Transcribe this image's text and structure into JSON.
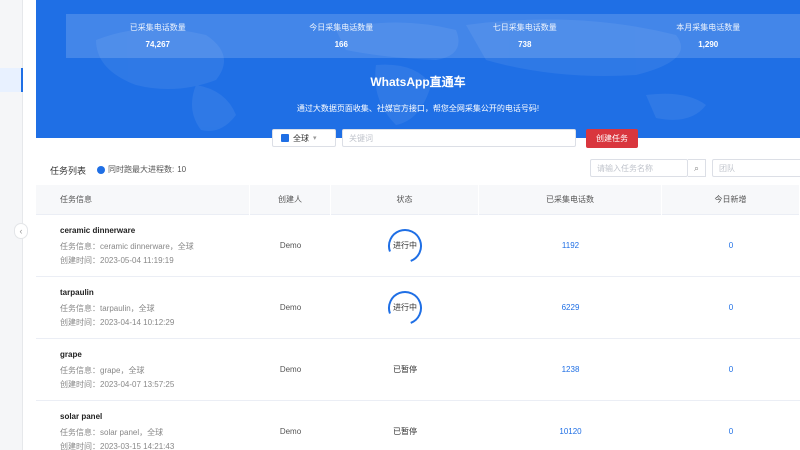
{
  "stats": [
    {
      "label": "已采集电话数量",
      "value": "74,267"
    },
    {
      "label": "今日采集电话数量",
      "value": "166"
    },
    {
      "label": "七日采集电话数量",
      "value": "738"
    },
    {
      "label": "本月采集电话数量",
      "value": "1,290"
    }
  ],
  "banner": {
    "title": "WhatsApp直通车",
    "subtitle": "通过大数据页面收集、社媒官方接口，帮您全网采集公开的电话号码!"
  },
  "search": {
    "scope": "全球",
    "placeholder": "关键词",
    "create_label": "创建任务"
  },
  "list": {
    "title": "任务列表",
    "process_label": "同时跑最大进程数:",
    "process_value": "10",
    "task_search_placeholder": "请输入任务名称",
    "team_placeholder": "团队"
  },
  "table": {
    "headers": [
      "任务信息",
      "创建人",
      "状态",
      "已采集电话数",
      "今日新增"
    ],
    "rows": [
      {
        "name": "ceramic dinnerware",
        "info": "任务信息：ceramic dinnerware，全球",
        "time": "创建时间：2023-05-04 11:19:19",
        "creator": "Demo",
        "status": "进行中",
        "running": true,
        "collected": "1192",
        "today": "0"
      },
      {
        "name": "tarpaulin",
        "info": "任务信息：tarpaulin，全球",
        "time": "创建时间：2023-04-14 10:12:29",
        "creator": "Demo",
        "status": "进行中",
        "running": true,
        "collected": "6229",
        "today": "0"
      },
      {
        "name": "grape",
        "info": "任务信息：grape，全球",
        "time": "创建时间：2023-04-07 13:57:25",
        "creator": "Demo",
        "status": "已暂停",
        "running": false,
        "collected": "1238",
        "today": "0"
      },
      {
        "name": "solar panel",
        "info": "任务信息：solar panel，全球",
        "time": "创建时间：2023-03-15 14:21:43",
        "creator": "Demo",
        "status": "已暂停",
        "running": false,
        "collected": "10120",
        "today": "0"
      }
    ]
  },
  "colors": {
    "primary": "#1f6fe5",
    "danger": "#d9363e"
  },
  "icons": {
    "collapse": "chevron-left-icon",
    "search": "search-icon",
    "info": "info-icon"
  }
}
